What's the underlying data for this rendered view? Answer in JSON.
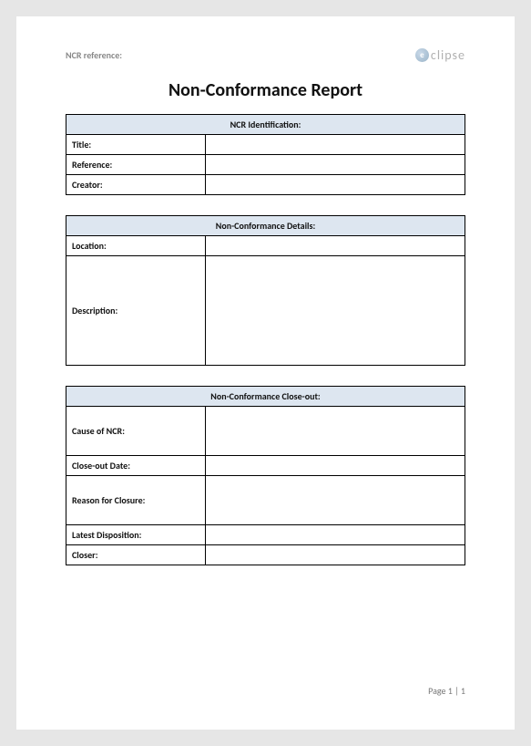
{
  "header": {
    "ncr_reference_label": "NCR reference:",
    "logo_text": "clipse"
  },
  "title": "Non-Conformance Report",
  "sections": {
    "identification": {
      "heading": "NCR Identification:",
      "rows": [
        {
          "label": "Title:",
          "value": ""
        },
        {
          "label": "Reference:",
          "value": ""
        },
        {
          "label": "Creator:",
          "value": ""
        }
      ]
    },
    "details": {
      "heading": "Non-Conformance Details:",
      "rows": [
        {
          "label": "Location:",
          "value": ""
        },
        {
          "label": "Description:",
          "value": ""
        }
      ]
    },
    "closeout": {
      "heading": "Non-Conformance Close-out:",
      "rows": [
        {
          "label": "Cause of NCR:",
          "value": ""
        },
        {
          "label": "Close-out Date:",
          "value": ""
        },
        {
          "label": "Reason for Closure:",
          "value": ""
        },
        {
          "label": "Latest Disposition:",
          "value": ""
        },
        {
          "label": "Closer:",
          "value": ""
        }
      ]
    }
  },
  "footer": {
    "page_text": "Page 1 | 1"
  }
}
